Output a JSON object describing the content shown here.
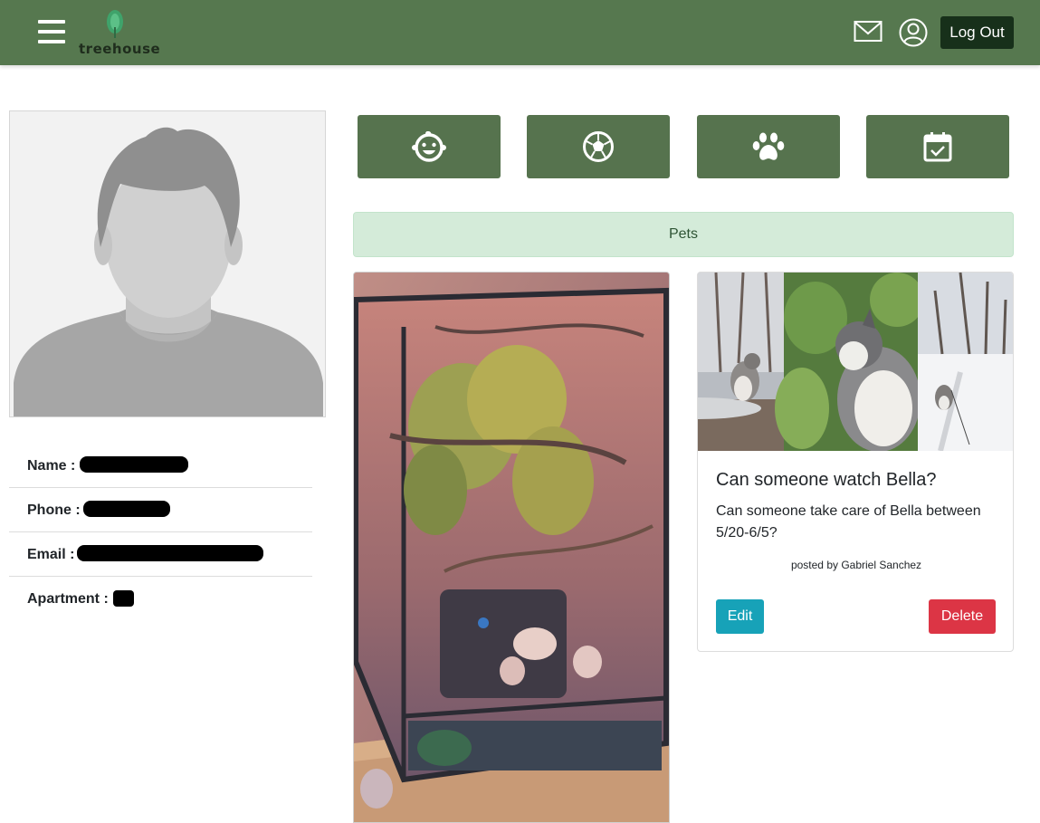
{
  "header": {
    "logo_text": "treehouse",
    "logout_label": "Log Out",
    "menu_icon": "hamburger-icon",
    "mail_icon": "envelope-icon",
    "profile_icon": "user-circle-icon",
    "brand_color": "#56784f"
  },
  "profile": {
    "fields": [
      {
        "label": "Name :",
        "value_redacted": true
      },
      {
        "label": "Phone :",
        "value_redacted": true
      },
      {
        "label": "Email :",
        "value_redacted": true
      },
      {
        "label": "Apartment :",
        "value_redacted": true
      }
    ]
  },
  "categories": [
    {
      "icon": "baby-face-icon"
    },
    {
      "icon": "soccer-ball-icon"
    },
    {
      "icon": "paw-icon"
    },
    {
      "icon": "calendar-check-icon"
    }
  ],
  "section": {
    "title": "Pets"
  },
  "post": {
    "title": "Can someone watch Bella?",
    "body": "Can someone take care of Bella between 5/20-6/5?",
    "meta": "posted by Gabriel Sanchez",
    "edit_label": "Edit",
    "delete_label": "Delete"
  }
}
